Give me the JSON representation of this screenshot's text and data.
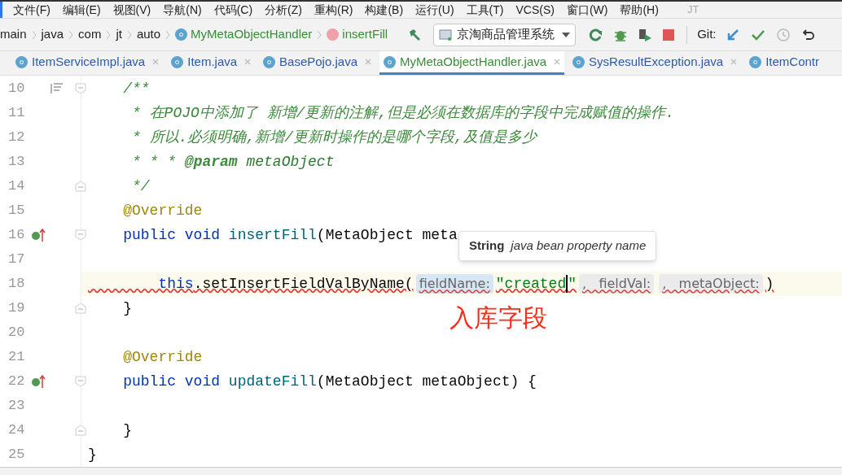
{
  "menu": {
    "items": [
      "文件(F)",
      "编辑(E)",
      "视图(V)",
      "导航(N)",
      "代码(C)",
      "分析(Z)",
      "重构(R)",
      "构建(B)",
      "运行(U)",
      "工具(T)",
      "VCS(S)",
      "窗口(W)",
      "帮助(H)"
    ],
    "title": "JT"
  },
  "breadcrumbs": [
    {
      "label": "main",
      "kind": "folder"
    },
    {
      "label": "java",
      "kind": "folder"
    },
    {
      "label": "com",
      "kind": "folder"
    },
    {
      "label": "jt",
      "kind": "folder"
    },
    {
      "label": "auto",
      "kind": "folder"
    },
    {
      "label": "MyMetaObjectHandler",
      "kind": "class"
    },
    {
      "label": "insertFill",
      "kind": "method"
    }
  ],
  "run_config": {
    "label": "京淘商品管理系统"
  },
  "git_label": "Git:",
  "tabs": [
    {
      "label": "ItemServiceImpl.java",
      "selected": false,
      "closable": true
    },
    {
      "label": "Item.java",
      "selected": false,
      "closable": true
    },
    {
      "label": "BasePojo.java",
      "selected": false,
      "closable": true
    },
    {
      "label": "MyMetaObjectHandler.java",
      "selected": true,
      "closable": true
    },
    {
      "label": "SysResultException.java",
      "selected": false,
      "closable": true
    },
    {
      "label": "ItemContr",
      "selected": false,
      "closable": false
    }
  ],
  "code_lines": [
    {
      "number": "10",
      "current": false,
      "implements": false,
      "fold_start": true,
      "fold_end": false,
      "structure": true,
      "tokens": [
        {
          "kind": "comment",
          "text": "    /**"
        }
      ]
    },
    {
      "number": "11",
      "current": false,
      "implements": false,
      "fold_start": false,
      "fold_end": false,
      "structure": false,
      "tokens": [
        {
          "kind": "comment",
          "text": "     * 在POJO中添加了 新增/更新的注解,但是必须在数据库的字段中完成赋值的操作."
        }
      ]
    },
    {
      "number": "12",
      "current": false,
      "implements": false,
      "fold_start": false,
      "fold_end": false,
      "structure": false,
      "tokens": [
        {
          "kind": "comment",
          "text": "     * 所以.必须明确,新增/更新时操作的是哪个字段,及值是多少"
        }
      ]
    },
    {
      "number": "13",
      "current": false,
      "implements": false,
      "fold_start": false,
      "fold_end": false,
      "structure": false,
      "tokens": [
        {
          "kind": "comment",
          "text": "     * * * "
        },
        {
          "kind": "doctag",
          "text": "@param"
        },
        {
          "kind": "docvalue",
          "text": " metaObject"
        }
      ]
    },
    {
      "number": "14",
      "current": false,
      "implements": false,
      "fold_start": false,
      "fold_end": true,
      "structure": false,
      "tokens": [
        {
          "kind": "comment",
          "text": "     */"
        }
      ]
    },
    {
      "number": "15",
      "current": false,
      "implements": false,
      "fold_start": false,
      "fold_end": false,
      "structure": false,
      "tokens": [
        {
          "kind": "annotation",
          "text": "    @Override"
        }
      ]
    },
    {
      "number": "16",
      "current": false,
      "implements": true,
      "fold_start": true,
      "fold_end": false,
      "structure": false,
      "tokens": [
        {
          "kind": "keyword",
          "text": "    public void "
        },
        {
          "kind": "method",
          "text": "insertFill"
        },
        {
          "kind": "plain",
          "text": "(MetaObject meta"
        }
      ]
    },
    {
      "number": "17",
      "current": false,
      "implements": false,
      "fold_start": false,
      "fold_end": false,
      "structure": false
    },
    {
      "number": "18",
      "current": true,
      "implements": false,
      "fold_start": false,
      "fold_end": false,
      "structure": false,
      "tokens": [
        {
          "kind": "keyword",
          "text": "        this"
        },
        {
          "kind": "plain",
          "text": ".setInsertFieldValByName("
        },
        {
          "kind": "hint",
          "text": "fieldName:",
          "selected": true
        },
        {
          "kind": "string",
          "text": "\"created",
          "caret": true
        },
        {
          "kind": "string",
          "text": "\"",
          "caret": false
        },
        {
          "kind": "hint",
          "text": ",   fieldVal:",
          "selected": false
        },
        {
          "kind": "hint",
          "text": ",   metaObject:",
          "selected": false
        },
        {
          "kind": "plain",
          "text": ")"
        }
      ]
    },
    {
      "number": "19",
      "current": false,
      "implements": false,
      "fold_start": false,
      "fold_end": true,
      "structure": false,
      "tokens": [
        {
          "kind": "plain",
          "text": "    }"
        }
      ]
    },
    {
      "number": "20",
      "current": false,
      "implements": false,
      "fold_start": false,
      "fold_end": false,
      "structure": false
    },
    {
      "number": "21",
      "current": false,
      "implements": false,
      "fold_start": false,
      "fold_end": false,
      "structure": false,
      "tokens": [
        {
          "kind": "annotation",
          "text": "    @Override"
        }
      ]
    },
    {
      "number": "22",
      "current": false,
      "implements": true,
      "fold_start": true,
      "fold_end": false,
      "structure": false,
      "tokens": [
        {
          "kind": "keyword",
          "text": "    public void "
        },
        {
          "kind": "method",
          "text": "updateFill"
        },
        {
          "kind": "plain",
          "text": "(MetaObject metaObject) {"
        }
      ]
    },
    {
      "number": "23",
      "current": false,
      "implements": false,
      "fold_start": false,
      "fold_end": false,
      "structure": false
    },
    {
      "number": "24",
      "current": false,
      "implements": false,
      "fold_start": false,
      "fold_end": true,
      "structure": false,
      "tokens": [
        {
          "kind": "plain",
          "text": "    }"
        }
      ]
    },
    {
      "number": "25",
      "current": false,
      "implements": false,
      "fold_start": false,
      "fold_end": false,
      "structure": false,
      "tokens": [
        {
          "kind": "plain",
          "text": "}"
        }
      ]
    }
  ],
  "tooltip": {
    "type": "String",
    "description": "java bean property name"
  },
  "annotation_note": "入库字段"
}
